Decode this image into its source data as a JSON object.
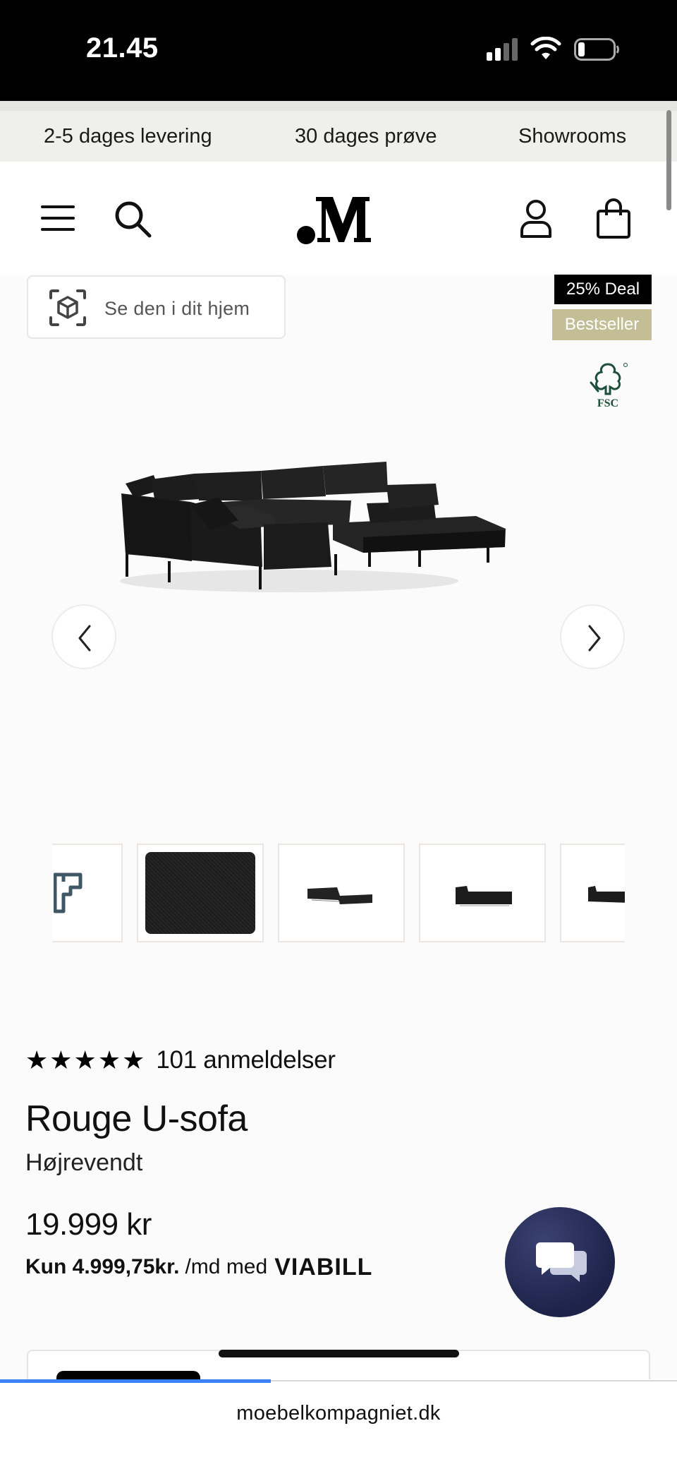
{
  "status_bar": {
    "time": "21.45",
    "signal": "signal-icon",
    "wifi": "wifi-icon",
    "battery": "battery-icon"
  },
  "promo_bar": {
    "items": [
      "2-5 dages levering",
      "30 dages prøve",
      "Showrooms"
    ]
  },
  "header": {
    "menu_icon": "hamburger-menu-icon",
    "search_icon": "search-icon",
    "logo_text": ".M",
    "account_icon": "user-icon",
    "cart_icon": "shopping-bag-icon"
  },
  "product_gallery": {
    "ar_button_label": "Se den i dit hjem",
    "badges": {
      "deal": "25% Deal",
      "bestseller": "Bestseller"
    },
    "fsc_label": "FSC",
    "prev_icon": "chevron-left-icon",
    "next_icon": "chevron-right-icon",
    "thumbnails": [
      {
        "name": "dimensions-diagram"
      },
      {
        "name": "fabric-swatch"
      },
      {
        "name": "sofa-angle-view"
      },
      {
        "name": "sofa-side-view"
      },
      {
        "name": "sofa-back-view"
      }
    ]
  },
  "product": {
    "stars": "★★★★★",
    "rating": 5,
    "reviews": "101 anmeldelser",
    "title": "Rouge U-sofa",
    "variant": "Højrevendt",
    "price": "19.999 kr",
    "finance_amount": "Kun 4.999,75kr.",
    "finance_per": "/md med",
    "finance_brand": "VIABILL"
  },
  "chat_icon": "chat-bubbles-icon",
  "browser": {
    "url": "moebelkompagniet.dk",
    "load_progress": 0.4
  },
  "colors": {
    "accent_badge": "#c3be96",
    "chat_bg": "#1d2349",
    "progress": "#3a82f6"
  }
}
